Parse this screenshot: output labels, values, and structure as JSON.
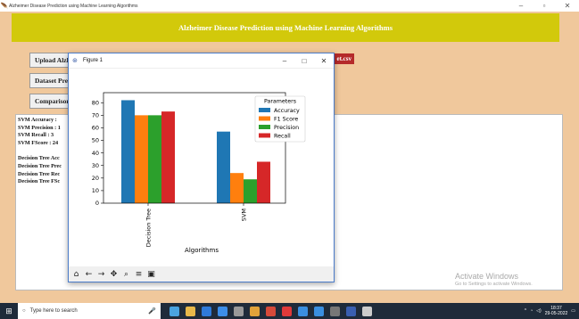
{
  "app": {
    "window_title": "Alzheimer Disease Prediction using Machine Learning Algorithms",
    "banner": "Alzheimer Disease Prediction using Machine Learning Algorithms",
    "buttons": {
      "upload": "Upload Alzheimer Dataset",
      "dataset": "Dataset Preprocessing",
      "comparison": "Comparison Graph"
    },
    "dataset_path": "et.csv",
    "output_lines": [
      "SVM Accuracy  :",
      "SVM Precision : 1",
      "SVM Recall    : 3",
      "SVM FScore    : 24",
      "",
      "Decision Tree Acc",
      "Decision Tree Prec",
      "Decision Tree Rec",
      "Decision Tree FSc"
    ],
    "activate": {
      "line1": "Activate Windows",
      "line2": "Go to Settings to activate Windows."
    }
  },
  "figure": {
    "title": "Figure 1",
    "toolbar": [
      "home-icon",
      "back-icon",
      "forward-icon",
      "pan-icon",
      "zoom-icon",
      "configure-icon",
      "save-icon"
    ]
  },
  "chart_data": {
    "type": "bar",
    "categories": [
      "Decision Tree",
      "SVM"
    ],
    "series": [
      {
        "name": "Accuracy",
        "color": "#1f77b4",
        "values": [
          82,
          57
        ]
      },
      {
        "name": "F1 Score",
        "color": "#ff7f0e",
        "values": [
          70,
          24
        ]
      },
      {
        "name": "Precision",
        "color": "#2ca02c",
        "values": [
          70,
          19
        ]
      },
      {
        "name": "Recall",
        "color": "#d62728",
        "values": [
          73,
          33
        ]
      }
    ],
    "xlabel": "Algorithms",
    "ylabel": "",
    "legend_title": "Parameters",
    "legend_position": "top-right",
    "ylim": [
      0,
      88
    ],
    "yticks": [
      0,
      10,
      20,
      30,
      40,
      50,
      60,
      70,
      80
    ]
  },
  "taskbar": {
    "search_placeholder": "Type here to search",
    "time": "18:37",
    "date": "29-05-2022",
    "apps": [
      "#4aa3df",
      "#e8b84a",
      "#2f7ad9",
      "#3d8ee8",
      "#999999",
      "#e0a23a",
      "#d64a3a",
      "#e03a3a",
      "#3a8fe0",
      "#3a8fe0",
      "#777777",
      "#3a5fb0",
      "#cccccc"
    ]
  }
}
